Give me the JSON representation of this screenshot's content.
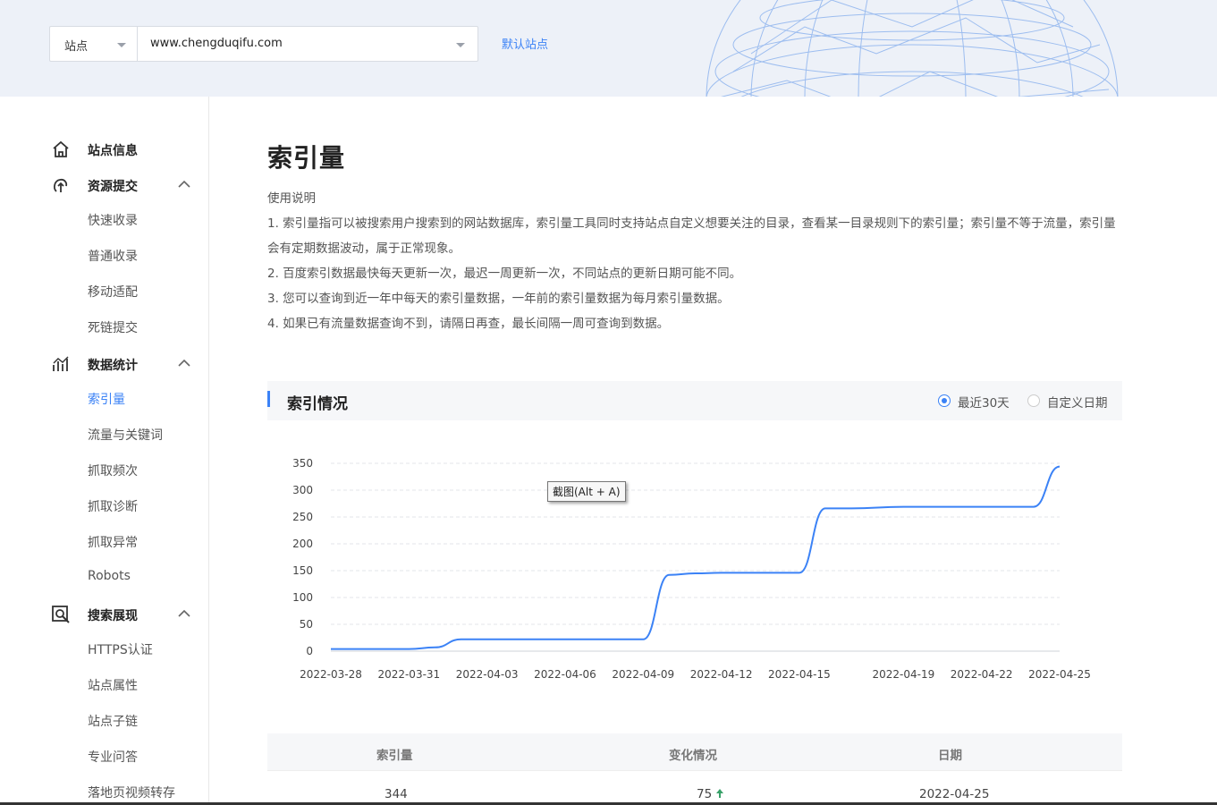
{
  "header": {
    "site_type_label": "站点",
    "domain_value": "www.chengduqifu.com",
    "default_site_link": "默认站点"
  },
  "sidebar": {
    "groups": [
      {
        "label": "站点信息",
        "icon": "home-icon",
        "expanded": false,
        "items": []
      },
      {
        "label": "资源提交",
        "icon": "submit-icon",
        "expanded": true,
        "items": [
          "快速收录",
          "普通收录",
          "移动适配",
          "死链提交"
        ]
      },
      {
        "label": "数据统计",
        "icon": "stats-icon",
        "expanded": true,
        "items": [
          "索引量",
          "流量与关键词",
          "抓取频次",
          "抓取诊断",
          "抓取异常",
          "Robots"
        ]
      },
      {
        "label": "搜索展现",
        "icon": "search-display-icon",
        "expanded": true,
        "items": [
          "HTTPS认证",
          "站点属性",
          "站点子链",
          "专业问答",
          "落地页视频转存"
        ]
      }
    ],
    "active_item": "索引量"
  },
  "main": {
    "title": "索引量",
    "intro": {
      "heading": "使用说明",
      "lines": [
        "1. 索引量指可以被搜索用户搜索到的网站数据库，索引量工具同时支持站点自定义想要关注的目录，查看某一目录规则下的索引量；索引量不等于流量，索引量会有定期数据波动，属于正常现象。",
        "2. 百度索引数据最快每天更新一次，最迟一周更新一次，不同站点的更新日期可能不同。",
        "3. 您可以查询到近一年中每天的索引量数据，一年前的索引量数据为每月索引量数据。",
        "4. 如果已有流量数据查询不到，请隔日再查，最长间隔一周可查询到数据。"
      ]
    },
    "section": {
      "title": "索引情况",
      "options": [
        "最近30天",
        "自定义日期"
      ],
      "selected": "最近30天"
    },
    "tooltip": "截图(Alt + A)",
    "table": {
      "headers": [
        "索引量",
        "变化情况",
        "日期"
      ],
      "rows": [
        {
          "count": "344",
          "change": "75",
          "change_dir": "up",
          "date": "2022-04-25"
        }
      ]
    }
  },
  "chart_data": {
    "type": "line",
    "ylim": [
      0,
      350
    ],
    "yticks": [
      0,
      50,
      100,
      150,
      200,
      250,
      300,
      350
    ],
    "xticks": [
      "2022-03-28",
      "2022-03-31",
      "2022-04-03",
      "2022-04-06",
      "2022-04-09",
      "2022-04-12",
      "2022-04-15",
      "2022-04-19",
      "2022-04-22",
      "2022-04-25"
    ],
    "grid": true,
    "color": "#3b82f6",
    "series": [
      {
        "x": [
          "2022-03-28",
          "2022-03-29",
          "2022-03-30",
          "2022-03-31",
          "2022-04-01",
          "2022-04-02",
          "2022-04-03",
          "2022-04-04",
          "2022-04-05",
          "2022-04-06",
          "2022-04-07",
          "2022-04-08",
          "2022-04-09",
          "2022-04-10",
          "2022-04-11",
          "2022-04-12",
          "2022-04-13",
          "2022-04-14",
          "2022-04-15",
          "2022-04-16",
          "2022-04-17",
          "2022-04-19",
          "2022-04-20",
          "2022-04-21",
          "2022-04-22",
          "2022-04-23",
          "2022-04-24",
          "2022-04-25"
        ],
        "values": [
          4,
          4,
          4,
          4,
          7,
          22,
          22,
          22,
          22,
          22,
          22,
          22,
          22,
          142,
          145,
          146,
          146,
          146,
          146,
          266,
          266,
          269,
          269,
          269,
          269,
          269,
          269,
          344
        ]
      }
    ]
  }
}
